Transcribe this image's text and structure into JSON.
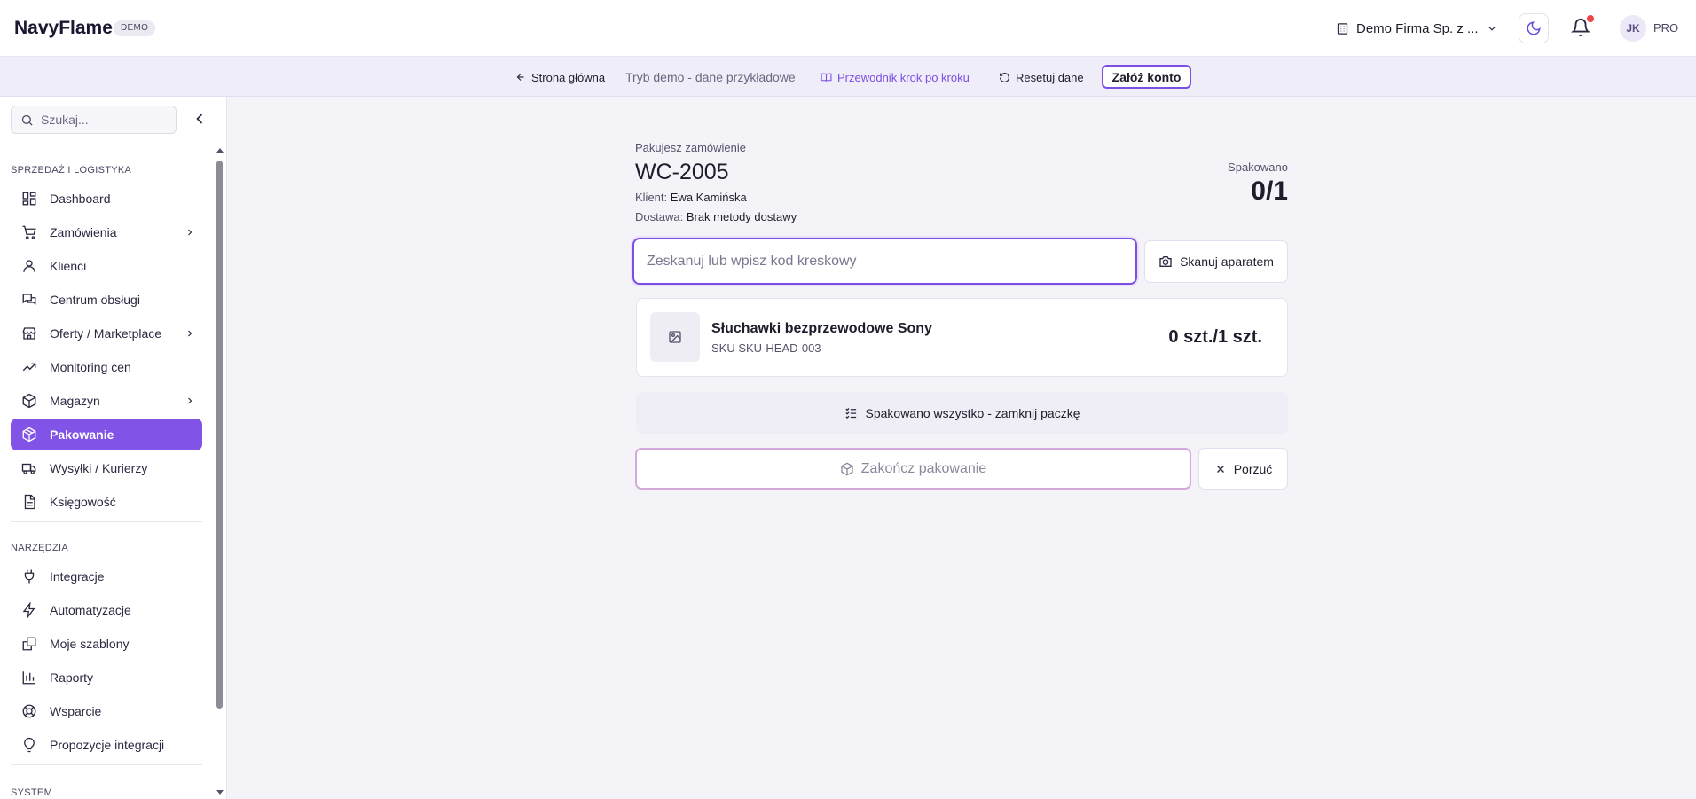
{
  "app": {
    "name": "NavyFlame",
    "badge": "DEMO"
  },
  "header": {
    "company": "Demo Firma Sp. z ...",
    "avatar_initials": "JK",
    "plan": "PRO",
    "notification_dot_color": "#ef4444"
  },
  "demo_bar": {
    "home": "Strona główna",
    "mode_text": "Tryb demo - dane przykładowe",
    "guide": "Przewodnik krok po kroku",
    "reset": "Resetuj dane",
    "create_account": "Załóż konto"
  },
  "sidebar": {
    "search_placeholder": "Szukaj...",
    "sections": {
      "sales": "SPRZEDAŻ I LOGISTYKA",
      "tools": "NARZĘDZIA",
      "system": "SYSTEM"
    },
    "items": [
      {
        "label": "Dashboard",
        "icon": "dashboard-icon"
      },
      {
        "label": "Zamówienia",
        "icon": "cart-icon",
        "expandable": true
      },
      {
        "label": "Klienci",
        "icon": "user-icon"
      },
      {
        "label": "Centrum obsługi",
        "icon": "messages-icon"
      },
      {
        "label": "Oferty / Marketplace",
        "icon": "store-icon",
        "expandable": true
      },
      {
        "label": "Monitoring cen",
        "icon": "trend-icon"
      },
      {
        "label": "Magazyn",
        "icon": "box-icon",
        "expandable": true
      },
      {
        "label": "Pakowanie",
        "icon": "package-icon",
        "active": true
      },
      {
        "label": "Wysyłki / Kurierzy",
        "icon": "truck-icon"
      },
      {
        "label": "Księgowość",
        "icon": "document-icon"
      }
    ],
    "tools": [
      {
        "label": "Integracje",
        "icon": "plug-icon"
      },
      {
        "label": "Automatyzacje",
        "icon": "bolt-icon"
      },
      {
        "label": "Moje szablony",
        "icon": "templates-icon"
      },
      {
        "label": "Raporty",
        "icon": "bar-chart-icon"
      },
      {
        "label": "Wsparcie",
        "icon": "lifebuoy-icon"
      },
      {
        "label": "Propozycje integracji",
        "icon": "lightbulb-icon"
      }
    ]
  },
  "packing": {
    "subtitle": "Pakujesz zamówienie",
    "order_number": "WC-2005",
    "client_label": "Klient:",
    "client_name": "Ewa Kamińska",
    "delivery_label": "Dostawa:",
    "delivery_value": "Brak metody dostawy",
    "packed_label": "Spakowano",
    "packed_value": "0/1",
    "barcode_placeholder": "Zeskanuj lub wpisz kod kreskowy",
    "scan_camera": "Skanuj aparatem",
    "product": {
      "name": "Słuchawki bezprzewodowe Sony",
      "sku": "SKU SKU-HEAD-003",
      "qty": "0 szt./1 szt."
    },
    "pack_all": "Spakowano wszystko - zamknij paczkę",
    "finish": "Zakończ pakowanie",
    "abandon": "Porzuć"
  },
  "colors": {
    "accent": "#8153e6",
    "accent_border": "#7c4ee4"
  }
}
